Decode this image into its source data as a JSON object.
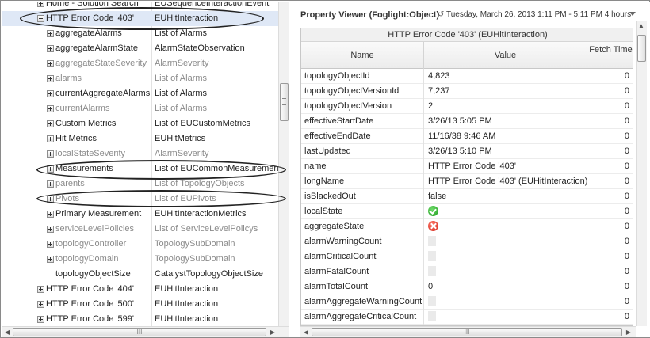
{
  "tree": {
    "rows": [
      {
        "name": "Home - Solution Search",
        "type": "EUSequenceInteractionEvent",
        "indent": 1,
        "expander": "plus",
        "dim": false
      },
      {
        "name": "HTTP Error Code '403'",
        "type": "EUHitInteraction",
        "indent": 1,
        "expander": "minus",
        "dim": false,
        "selected": true
      },
      {
        "name": "aggregateAlarms",
        "type": "List of Alarms",
        "indent": 2,
        "expander": "plus",
        "dim": false
      },
      {
        "name": "aggregateAlarmState",
        "type": "AlarmStateObservation",
        "indent": 2,
        "expander": "plus",
        "dim": false
      },
      {
        "name": "aggregateStateSeverity",
        "type": "AlarmSeverity",
        "indent": 2,
        "expander": "plus",
        "dim": true
      },
      {
        "name": "alarms",
        "type": "List of Alarms",
        "indent": 2,
        "expander": "plus",
        "dim": true
      },
      {
        "name": "currentAggregateAlarms",
        "type": "List of Alarms",
        "indent": 2,
        "expander": "plus",
        "dim": false
      },
      {
        "name": "currentAlarms",
        "type": "List of Alarms",
        "indent": 2,
        "expander": "plus",
        "dim": true
      },
      {
        "name": "Custom Metrics",
        "type": "List of EUCustomMetrics",
        "indent": 2,
        "expander": "plus",
        "dim": false
      },
      {
        "name": "Hit Metrics",
        "type": "EUHitMetrics",
        "indent": 2,
        "expander": "plus",
        "dim": false
      },
      {
        "name": "localStateSeverity",
        "type": "AlarmSeverity",
        "indent": 2,
        "expander": "plus",
        "dim": true
      },
      {
        "name": "Measurements",
        "type": "List of EUCommonMeasurements",
        "indent": 2,
        "expander": "plus",
        "dim": false
      },
      {
        "name": "parents",
        "type": "List of TopologyObjects",
        "indent": 2,
        "expander": "plus",
        "dim": true
      },
      {
        "name": "Pivots",
        "type": "List of EUPivots",
        "indent": 2,
        "expander": "plus",
        "dim": true
      },
      {
        "name": "Primary Measurement",
        "type": "EUHitInteractionMetrics",
        "indent": 2,
        "expander": "plus",
        "dim": false
      },
      {
        "name": "serviceLevelPolicies",
        "type": "List of ServiceLevelPolicys",
        "indent": 2,
        "expander": "plus",
        "dim": true
      },
      {
        "name": "topologyController",
        "type": "TopologySubDomain",
        "indent": 2,
        "expander": "plus",
        "dim": true
      },
      {
        "name": "topologyDomain",
        "type": "TopologySubDomain",
        "indent": 2,
        "expander": "plus",
        "dim": true
      },
      {
        "name": "topologyObjectSize",
        "type": "CatalystTopologyObjectSize",
        "indent": 2,
        "expander": "none",
        "dim": false
      },
      {
        "name": "HTTP Error Code '404'",
        "type": "EUHitInteraction",
        "indent": 0,
        "expander": "plus",
        "dim": false
      },
      {
        "name": "HTTP Error Code '500'",
        "type": "EUHitInteraction",
        "indent": 0,
        "expander": "plus",
        "dim": false
      },
      {
        "name": "HTTP Error Code '599'",
        "type": "EUHitInteraction",
        "indent": 0,
        "expander": "plus",
        "dim": false
      }
    ],
    "scroll_grip": "III"
  },
  "viewer": {
    "title": "Property Viewer (Foglight:Object)",
    "time_icon": "clock-arrow-icon",
    "time_range": "Tuesday, March 26, 2013 1:11 PM - 5:11 PM 4 hours",
    "caption": "HTTP Error Code '403' (EUHitInteraction)",
    "columns": {
      "name": "Name",
      "value": "Value",
      "fetch": "Fetch Time"
    },
    "rows": [
      {
        "name": "topologyObjectId",
        "value": "4,823",
        "kind": "text",
        "fetch": "0"
      },
      {
        "name": "topologyObjectVersionId",
        "value": "7,237",
        "kind": "text",
        "fetch": "0"
      },
      {
        "name": "topologyObjectVersion",
        "value": "2",
        "kind": "text",
        "fetch": "0"
      },
      {
        "name": "effectiveStartDate",
        "value": "3/26/13 5:05 PM",
        "kind": "text",
        "fetch": "0"
      },
      {
        "name": "effectiveEndDate",
        "value": "11/16/38 9:46 AM",
        "kind": "text",
        "fetch": "0"
      },
      {
        "name": "lastUpdated",
        "value": "3/26/13 5:10 PM",
        "kind": "text",
        "fetch": "0"
      },
      {
        "name": "name",
        "value": "HTTP Error Code '403'",
        "kind": "text",
        "fetch": "0"
      },
      {
        "name": "longName",
        "value": "HTTP Error Code '403' (EUHitInteraction)",
        "kind": "text",
        "fetch": "0"
      },
      {
        "name": "isBlackedOut",
        "value": "false",
        "kind": "text",
        "fetch": "0"
      },
      {
        "name": "localState",
        "value": "",
        "kind": "ok-icon",
        "fetch": "0"
      },
      {
        "name": "aggregateState",
        "value": "",
        "kind": "error-icon",
        "fetch": "0"
      },
      {
        "name": "alarmWarningCount",
        "value": "",
        "kind": "blank",
        "fetch": "0"
      },
      {
        "name": "alarmCriticalCount",
        "value": "",
        "kind": "blank",
        "fetch": "0"
      },
      {
        "name": "alarmFatalCount",
        "value": "",
        "kind": "blank",
        "fetch": "0"
      },
      {
        "name": "alarmTotalCount",
        "value": "0",
        "kind": "text",
        "fetch": "0"
      },
      {
        "name": "alarmAggregateWarningCount",
        "value": "",
        "kind": "blank",
        "fetch": "0"
      },
      {
        "name": "alarmAggregateCriticalCount",
        "value": "",
        "kind": "blank",
        "fetch": "0"
      }
    ],
    "scroll_grip": "III"
  }
}
